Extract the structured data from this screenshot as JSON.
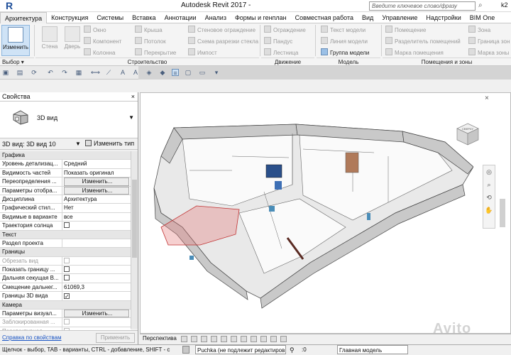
{
  "window": {
    "title": "Autodesk Revit 2017 -",
    "search_placeholder": "Введите ключевое слово/фразу",
    "user": "k2",
    "logo": "R"
  },
  "tabs": [
    "Архитектура",
    "Конструкция",
    "Системы",
    "Вставка",
    "Аннотации",
    "Анализ",
    "Формы и генплан",
    "Совместная работа",
    "Вид",
    "Управление",
    "Надстройки",
    "BIM One"
  ],
  "active_tab": "Архитектура",
  "ribbon": {
    "select_label": "Изменить",
    "select_group": "Выбор ▾",
    "build": {
      "wall": "Стена",
      "door": "Дверь",
      "window": "Окно",
      "component": "Компонент",
      "column": "Колонна",
      "roof": "Крыша",
      "ceiling": "Потолок",
      "floor": "Перекрытие",
      "curtain_system": "Стеновое ограждение",
      "curtain_grid": "Схема разрезки стекла",
      "mullion": "Импост",
      "group": "Строительство"
    },
    "circulation": {
      "railing": "Ограждение",
      "ramp": "Пандус",
      "stair": "Лестница",
      "group": "Движение"
    },
    "model": {
      "text": "Текст модели",
      "line": "Линия модели",
      "group_item": "Группа модели",
      "group": "Модель"
    },
    "room": {
      "room": "Помещение",
      "separator": "Разделитель помещений",
      "tag": "Марка помещения",
      "area": "Зона",
      "area_boundary": "Граница зоны",
      "area_tag": "Марка зоны",
      "group": "Помещения и зоны"
    }
  },
  "properties": {
    "title": "Свойства",
    "close": "×",
    "type_name": "3D вид",
    "view_selector": "3D вид: 3D вид 10",
    "edit_type": "Изменить тип",
    "rows": [
      {
        "kind": "sec",
        "k": "Графика"
      },
      {
        "k": "Уровень детализац...",
        "v": "Средний"
      },
      {
        "k": "Видимость частей",
        "v": "Показать оригинал"
      },
      {
        "k": "Переопределения ...",
        "v": "Изменить...",
        "btn": true
      },
      {
        "k": "Параметры отобра...",
        "v": "Изменить...",
        "btn": true
      },
      {
        "k": "Дисциплина",
        "v": "Архитектура"
      },
      {
        "k": "Графический стил...",
        "v": "Нет"
      },
      {
        "k": "Видимые в варианте",
        "v": "все"
      },
      {
        "k": "Траектория солнца",
        "cb": "off"
      },
      {
        "kind": "sec",
        "k": "Текст"
      },
      {
        "k": "Раздел проекта",
        "v": ""
      },
      {
        "kind": "sec",
        "k": "Границы"
      },
      {
        "k": "Обрезать вид",
        "cb": "dis",
        "dim": true
      },
      {
        "k": "Показать границу ...",
        "cb": "off"
      },
      {
        "k": "Дальняя секущая В...",
        "cb": "off"
      },
      {
        "k": "Смещение дальнег...",
        "v": "61069,3"
      },
      {
        "k": "Границы 3D вида",
        "cb": "on"
      },
      {
        "kind": "sec",
        "k": "Камера"
      },
      {
        "k": "Параметры визуал...",
        "v": "Изменить...",
        "btn": true
      },
      {
        "k": "Заблокированная ...",
        "cb": "dis",
        "dim": true
      },
      {
        "k": "Перспективная",
        "cb": "dis",
        "dim": true
      }
    ],
    "help_link": "Справка по свойствам",
    "apply": "Применить"
  },
  "viewport": {
    "view_close": "×",
    "viewcube_label": "СВЕРХУ"
  },
  "viewbar": {
    "scale": "Перспектива"
  },
  "status": {
    "hint": "Щелчок - выбор, TAB - варианты, CTRL - добавление, SHIFT - с",
    "workset": "Puchka (не подлежит редактиров",
    "count": ":0",
    "main_model": "Главная модель"
  },
  "watermark": "Avito"
}
